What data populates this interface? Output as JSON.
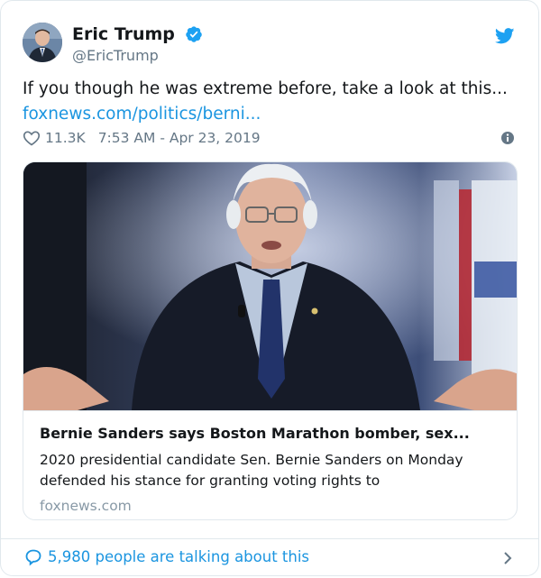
{
  "author": {
    "name": "Eric Trump",
    "handle": "@EricTrump"
  },
  "tweet": {
    "text": "If you though he was extreme before, take a look at this...",
    "link_text": "foxnews.com/politics/berni..."
  },
  "meta": {
    "likes": "11.3K",
    "timestamp": "7:53 AM - Apr 23, 2019"
  },
  "card": {
    "title": "Bernie Sanders says Boston Marathon bomber, sex...",
    "description": "2020 presidential candidate Sen. Bernie Sanders on Monday defended his stance for granting voting rights to",
    "domain": "foxnews.com"
  },
  "footer": {
    "talking": "5,980 people are talking about this"
  },
  "colors": {
    "link": "#1b95e0",
    "muted": "#657786",
    "border": "#e1e8ed"
  },
  "icons": [
    "verified-badge-icon",
    "twitter-bird-icon",
    "heart-icon",
    "info-icon",
    "speech-bubble-icon",
    "chevron-right-icon"
  ]
}
